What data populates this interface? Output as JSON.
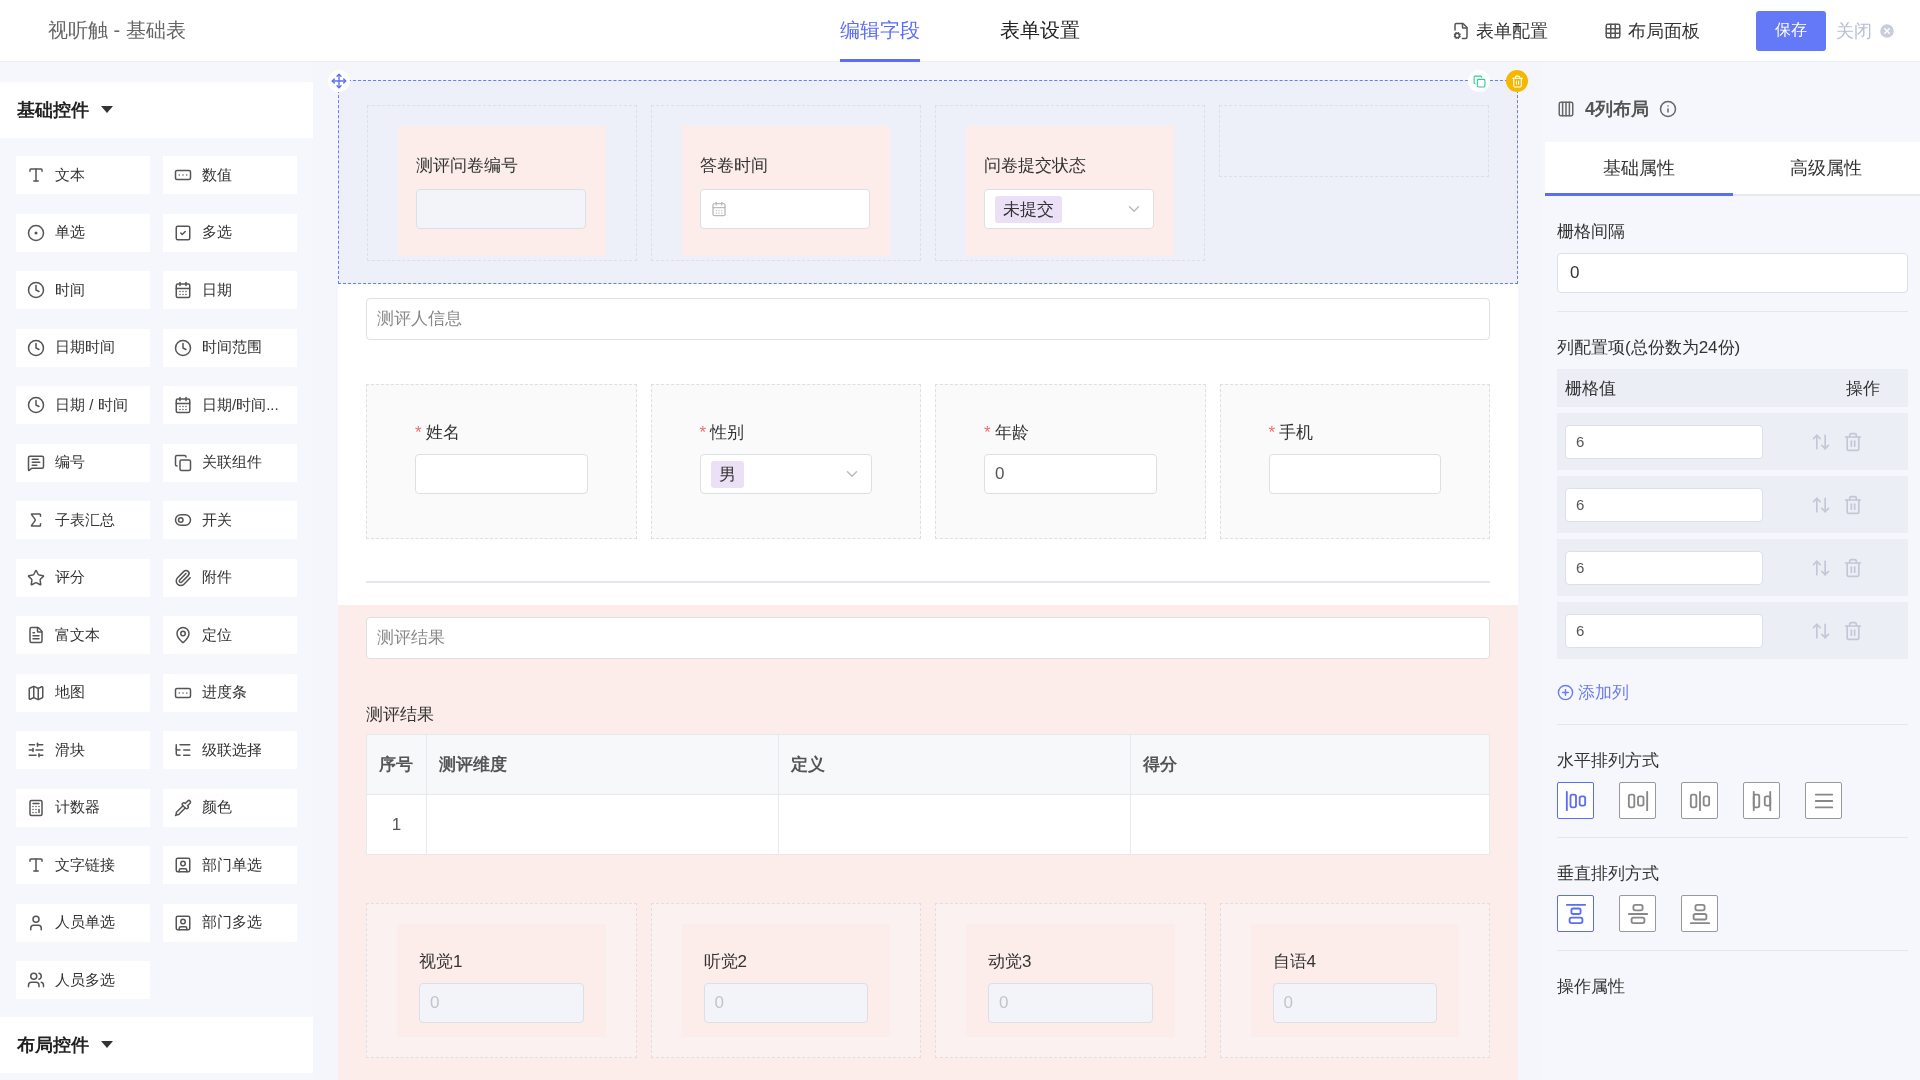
{
  "header": {
    "title": "视听触 - 基础表",
    "tabs": [
      {
        "label": "编辑字段",
        "selected": true
      },
      {
        "label": "表单设置",
        "selected": false
      }
    ],
    "actions": [
      {
        "label": "表单配置"
      },
      {
        "label": "布局面板"
      }
    ],
    "save_button": "保存",
    "close_button": "关闭"
  },
  "sidebar": {
    "sections": [
      {
        "title": "基础控件",
        "items": [
          "文本",
          "数值",
          "单选",
          "多选",
          "时间",
          "日期",
          "日期时间",
          "时间范围",
          "日期 / 时间",
          "日期/时间...",
          "编号",
          "关联组件",
          "子表汇总",
          "开关",
          "评分",
          "附件",
          "富文本",
          "定位",
          "地图",
          "进度条",
          "滑块",
          "级联选择",
          "计数器",
          "颜色",
          "文字链接",
          "部门单选",
          "人员单选",
          "部门多选",
          "人员多选"
        ]
      },
      {
        "title": "布局控件"
      }
    ]
  },
  "canvas": {
    "layout_block": {
      "selected": true,
      "columns": [
        {
          "kind": "text",
          "label": "测评问卷编号",
          "required": false
        },
        {
          "kind": "date",
          "label": "答卷时间",
          "required": false
        },
        {
          "kind": "select",
          "label": "问卷提交状态",
          "required": false,
          "value": "未提交"
        },
        {
          "kind": "empty"
        }
      ]
    },
    "required_mark": "*",
    "info_textarea": {
      "placeholder": "测评人信息"
    },
    "person_fields": [
      {
        "kind": "text",
        "label": "姓名",
        "required": true
      },
      {
        "kind": "select",
        "label": "性别",
        "required": true,
        "value": "男"
      },
      {
        "kind": "text",
        "label": "年龄",
        "required": true,
        "value": "0"
      },
      {
        "kind": "text",
        "label": "手机",
        "required": true
      }
    ],
    "result_section": {
      "textarea": {
        "placeholder": "测评结果"
      },
      "table": {
        "title": "测评结果",
        "columns": [
          "序号",
          "测评维度",
          "定义",
          "得分"
        ],
        "rows": [
          [
            "1",
            "",
            "",
            ""
          ]
        ]
      },
      "score_fields": [
        {
          "label": "视觉1",
          "placeholder": "0"
        },
        {
          "label": "听觉2",
          "placeholder": "0"
        },
        {
          "label": "动觉3",
          "placeholder": "0"
        },
        {
          "label": "自语4",
          "placeholder": "0"
        }
      ]
    }
  },
  "properties": {
    "title": "4列布局",
    "tabs": [
      {
        "label": "基础属性",
        "selected": true
      },
      {
        "label": "高级属性",
        "selected": false
      }
    ],
    "gutter": {
      "label": "栅格间隔",
      "value": "0"
    },
    "columns_config": {
      "title": "列配置项(总份数为24份)",
      "headers": [
        "栅格值",
        "操作"
      ],
      "values": [
        "6",
        "6",
        "6",
        "6"
      ],
      "add_button": "添加列"
    },
    "horizontal_align": {
      "label": "水平排列方式",
      "options": [
        {
          "selected": true
        },
        {
          "selected": false
        },
        {
          "selected": false
        },
        {
          "selected": false
        },
        {
          "selected": false
        }
      ]
    },
    "vertical_align": {
      "label": "垂直排列方式",
      "options": [
        {
          "selected": true
        },
        {
          "selected": false
        },
        {
          "selected": false
        }
      ]
    },
    "action_section": {
      "title": "操作属性"
    }
  }
}
